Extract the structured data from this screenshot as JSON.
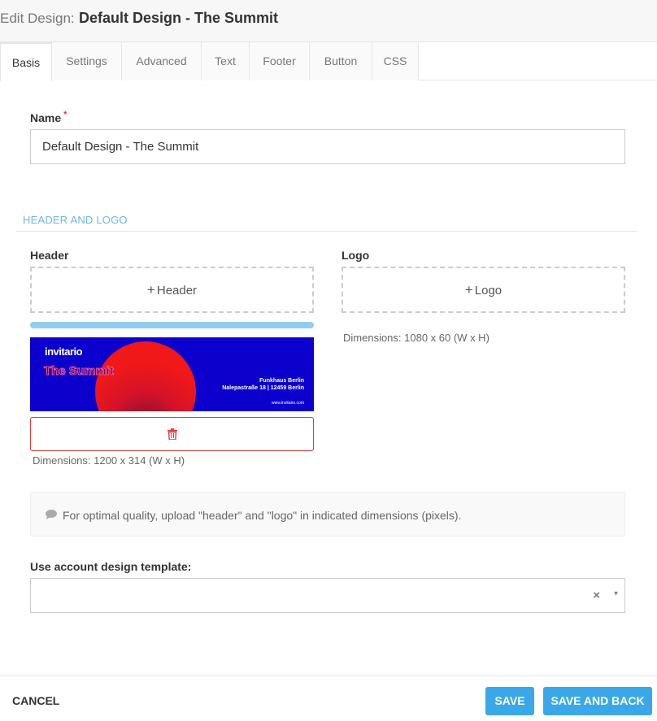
{
  "header": {
    "title_prefix": "Edit Design:",
    "title_name": "Default Design - The Summit"
  },
  "tabs": [
    {
      "label": "Basis",
      "active": true
    },
    {
      "label": "Settings"
    },
    {
      "label": "Advanced"
    },
    {
      "label": "Text"
    },
    {
      "label": "Footer"
    },
    {
      "label": "Button"
    },
    {
      "label": "CSS"
    }
  ],
  "form": {
    "name_label": "Name",
    "required_mark": "*",
    "name_value": "Default Design - The Summit",
    "section_title": "HEADER AND LOGO",
    "header_label": "Header",
    "header_upload": "Header",
    "header_upload_progress": 1.0,
    "header_dimensions": "Dimensions: 1200 x 314 (W x H)",
    "logo_label": "Logo",
    "logo_upload": "Logo",
    "logo_dimensions": "Dimensions: 1080 x 60 (W x H)",
    "info_text": "For optimal quality, upload \"header\" and \"logo\" in indicated dimensions (pixels).",
    "template_label": "Use account design template:",
    "template_value": "",
    "template_clear": "×",
    "template_caret": "▾"
  },
  "header_image": {
    "brand": "invitario",
    "event": "The Summit",
    "venue_line1": "Funkhaus Berlin",
    "venue_line2": "Nalepastraße 18 | 12459 Berlin",
    "url": "www.invitario.com",
    "colors": {
      "background": "#0b00cc",
      "circle": "#f01818"
    }
  },
  "footer": {
    "cancel": "CANCEL",
    "save": "SAVE",
    "save_and_back": "SAVE AND BACK"
  },
  "colors": {
    "accent": "#3aa8e8",
    "section_header": "#6cb8e8",
    "danger": "#e53935",
    "progress": "#90cdf0"
  }
}
